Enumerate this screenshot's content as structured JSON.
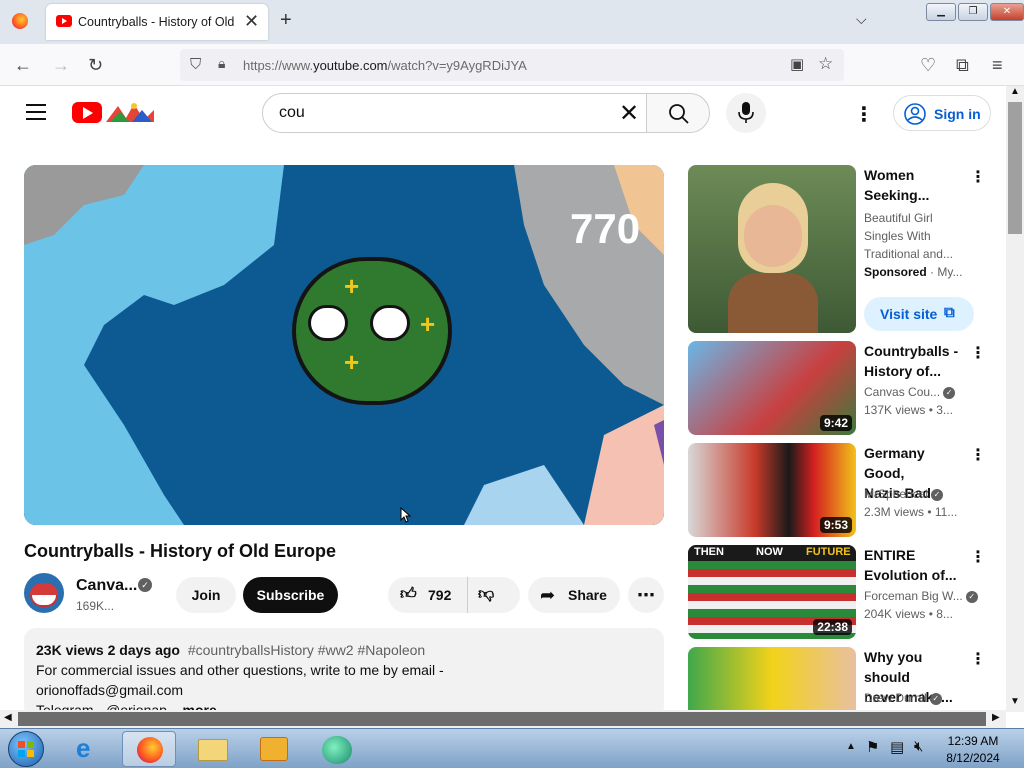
{
  "browser": {
    "tab_title": "Countryballs - History of Old Eu",
    "url_prefix": "https://www.",
    "url_domain": "youtube.com",
    "url_path": "/watch?v=y9AygRDiJYA"
  },
  "youtube": {
    "search_value": "cou",
    "signin_label": "Sign in"
  },
  "video": {
    "overlay_number": "770",
    "title": "Countryballs - History of Old Europe",
    "channel_name": "Canva...",
    "channel_subs": "169K...",
    "join_label": "Join",
    "subscribe_label": "Subscribe",
    "likes": "792",
    "share_label": "Share"
  },
  "description": {
    "stats": "23K views  2 days ago",
    "hashtags": "#countryballsHistory #ww2 #Napoleon",
    "line1": "For commercial issues and other questions, write to me by email -",
    "line2": "orionoffads@gmail.com",
    "line3": "Telegram - @orionap...",
    "more": "more"
  },
  "recommendations": [
    {
      "title_l1": "Women",
      "title_l2": "Seeking...",
      "desc_l1": "Beautiful Girl",
      "desc_l2": "Singles With",
      "desc_l3": "Traditional and...",
      "sponsored": "Sponsored",
      "advertiser": " · My...",
      "visit_label": "Visit site"
    },
    {
      "title_l1": "Countryballs -",
      "title_l2": "History of...",
      "channel": "Canvas Cou...",
      "meta": "137K views  • 3...",
      "duration": "9:42"
    },
    {
      "title_l1": "Germany Good,",
      "title_l2": "Nazis Bad",
      "channel": "MrSpherical",
      "meta": "2.3M views  • 11...",
      "duration": "9:53"
    },
    {
      "title_l1": "ENTIRE",
      "title_l2": "Evolution of...",
      "channel": "Forceman Big W...",
      "meta": "204K views  • 8...",
      "duration": "22:38",
      "thumb_labels": [
        "THEN",
        "NOW",
        "FUTURE"
      ]
    },
    {
      "title_l1": "Why you should",
      "title_l2": "never make...",
      "channel": "Drew Durnil"
    }
  ],
  "taskbar": {
    "time": "12:39 AM",
    "date": "8/12/2024"
  },
  "colors": {
    "yt_red": "#ff0000",
    "link_blue": "#065fd4",
    "map_sea": "#0d5a92"
  }
}
